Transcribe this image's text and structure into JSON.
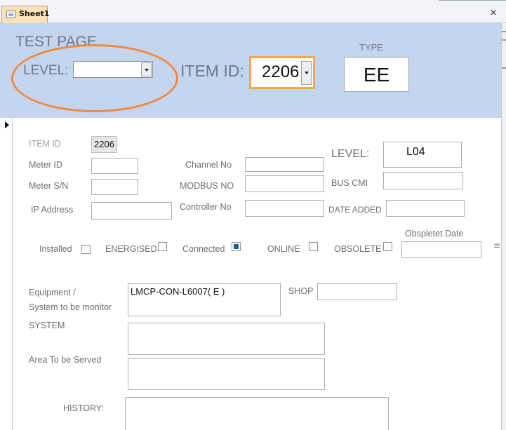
{
  "tab": {
    "label": "Sheet1",
    "close_glyph": "×"
  },
  "header": {
    "page_title": "TEST PAGE",
    "level_label": "LEVEL:",
    "level_value": "",
    "item_id_label": "ITEM ID:",
    "item_id_value": "2206",
    "type_label": "TYPE",
    "type_value": "EE"
  },
  "form": {
    "item_id": {
      "label": "ITEM ID",
      "value": "2206"
    },
    "meter_id": {
      "label": "Meter ID",
      "value": ""
    },
    "meter_sn": {
      "label": "Meter S/N",
      "value": ""
    },
    "ip_address": {
      "label": "IP Address",
      "value": ""
    },
    "channel_no": {
      "label": "Channel No",
      "value": ""
    },
    "modbus_no": {
      "label": "MODBUS NO",
      "value": ""
    },
    "controller_no": {
      "label": "Controller No",
      "value": ""
    },
    "level": {
      "label": "LEVEL:",
      "value": "L04"
    },
    "bus_cmi": {
      "label": "BUS CMI",
      "value": ""
    },
    "date_added": {
      "label": "DATE ADDED",
      "value": ""
    },
    "obsolete_date": {
      "label": "Obspletet Date",
      "value": ""
    },
    "checks": {
      "installed": {
        "label": "Installed",
        "checked": false
      },
      "energised": {
        "label": "ENERGISED",
        "checked": false
      },
      "connected": {
        "label": "Connected",
        "checked": true
      },
      "online": {
        "label": "ONLINE",
        "checked": false
      },
      "obsolete": {
        "label": "OBSOLETE",
        "checked": false
      }
    },
    "equipment": {
      "label_line1": "Equipment /",
      "label_line2": "System to be monitor",
      "value": "LMCP-CON-L6007( E )"
    },
    "shop": {
      "label": "SHOP",
      "value": ""
    },
    "system": {
      "label": "SYSTEM",
      "value": ""
    },
    "area": {
      "label": "Area To  be Served",
      "value": ""
    },
    "history": {
      "label": "HISTORY:",
      "value": ""
    }
  },
  "colors": {
    "header_bg": "#c4d6ef",
    "highlight_ring": "#f08a3e",
    "focus_border": "#f5a84a",
    "tab_bg": "#fbe1b9"
  },
  "icons": [
    "form-tab-icon",
    "close-icon",
    "dropdown-arrow-icon",
    "record-selector-arrow-icon",
    "resize-grip-icon"
  ]
}
